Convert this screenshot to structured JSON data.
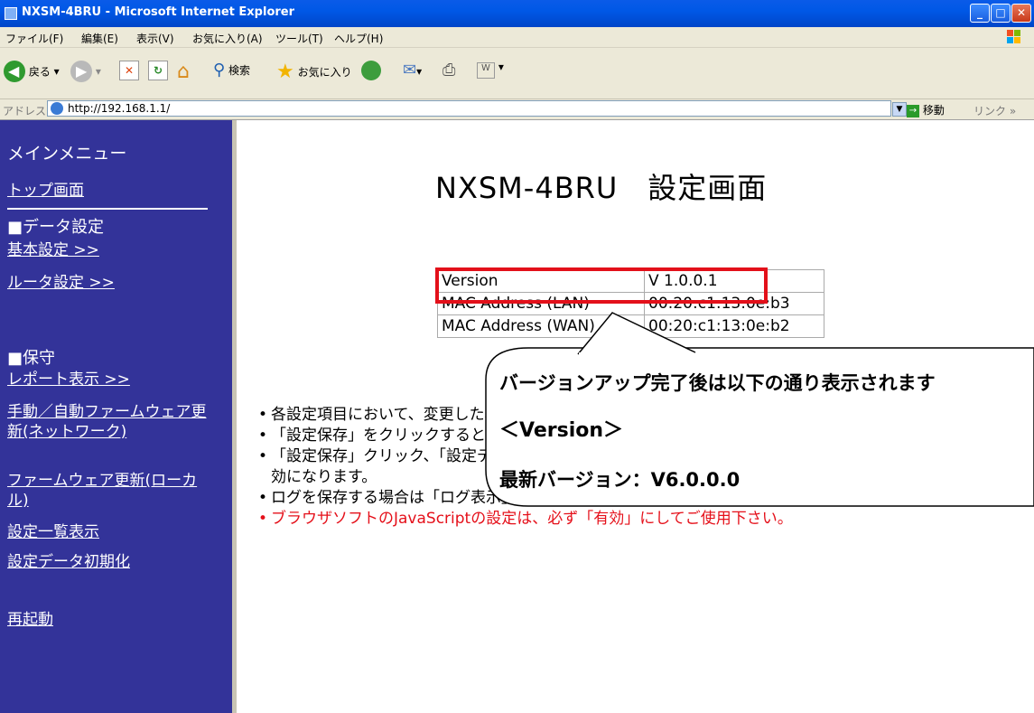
{
  "window": {
    "title": "NXSM-4BRU - Microsoft Internet Explorer"
  },
  "menu": [
    "ファイル(F)",
    "編集(E)",
    "表示(V)",
    "お気に入り(A)",
    "ツール(T)",
    "ヘルプ(H)"
  ],
  "toolbar": {
    "back": "戻る",
    "search": "検索",
    "favorites": "お気に入り"
  },
  "address": {
    "label": "アドレス(D)",
    "url": "http://192.168.1.1/",
    "go": "移動",
    "links": "リンク"
  },
  "sidebar": {
    "title": "メインメニュー",
    "top": "トップ画面",
    "data_heading": "■データ設定",
    "basic": "基本設定 >>",
    "router": "ルータ設定 >>",
    "maint_heading": "■保守",
    "report": "レポート表示 >>",
    "firmware_net": "手動／自動ファームウェア更新(ネットワーク)",
    "firmware_local": "ファームウェア更新(ローカル)",
    "list": "設定一覧表示",
    "init": "設定データ初期化",
    "reboot": "再起動"
  },
  "main": {
    "title": "NXSM-4BRU　設定画面",
    "table": [
      {
        "label": "Version",
        "value": "V 1.0.0.1"
      },
      {
        "label": "MAC Address (LAN)",
        "value": "00:20:c1:13:0e:b3"
      },
      {
        "label": "MAC Address (WAN)",
        "value": "00:20:c1:13:0e:b2"
      }
    ],
    "notes": [
      "各設定項目において、変更した場合は「設定保存」をクリックして下さい。",
      "「設定保存」をクリックすると、保存された値になります。",
      "「設定保存」クリック、「設定データ初期化」を行った後は、再起動を行うことにより、保存されたデータが有効になります。",
      "ログを保存する場合は「ログ表示」から「保存」を行ってください。「設定保存」では保存されません。",
      "ブラウザソフトのJavaScriptの設定は、必ず「有効」にしてご使用下さい。"
    ]
  },
  "callout": {
    "line1": "バージョンアップ完了後は以下の通り表示されます",
    "line2": "＜Version＞",
    "line3": "最新バージョン：V6.0.0.0"
  }
}
